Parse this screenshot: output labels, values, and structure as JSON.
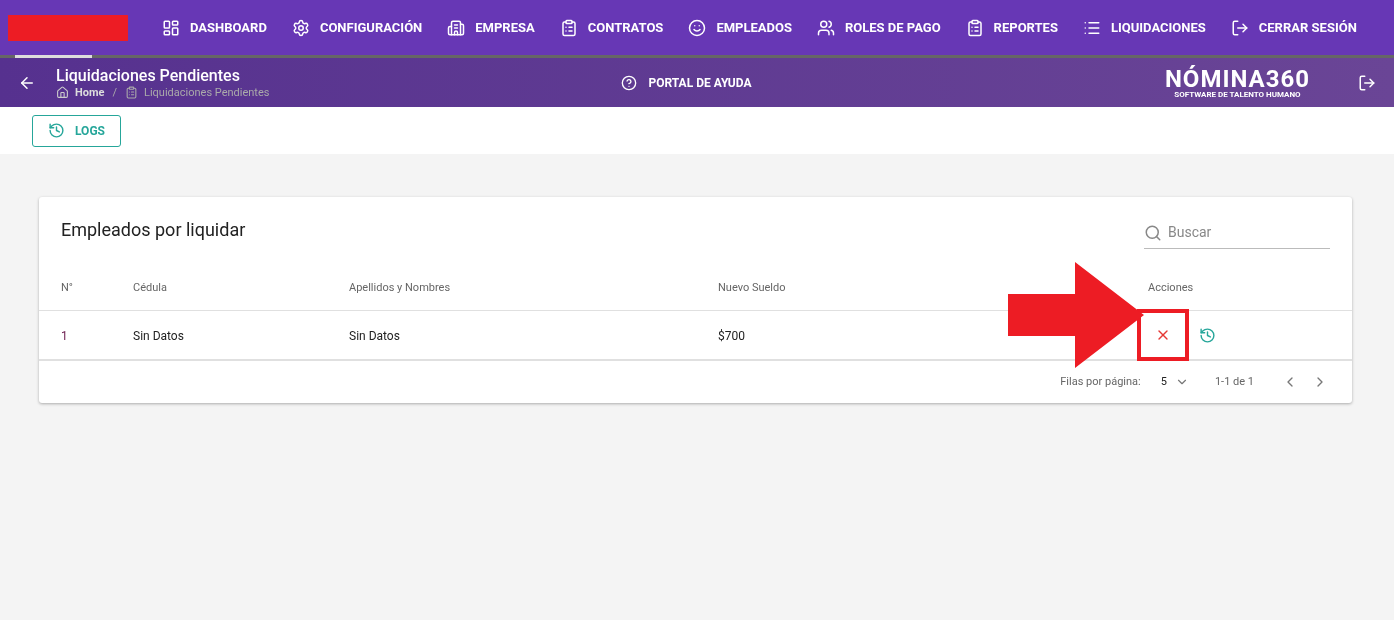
{
  "nav": {
    "items": [
      {
        "label": "DASHBOARD",
        "kind": "dashboard"
      },
      {
        "label": "CONFIGURACIÓN",
        "kind": "settings"
      },
      {
        "label": "EMPRESA",
        "kind": "building"
      },
      {
        "label": "CONTRATOS",
        "kind": "clipboard"
      },
      {
        "label": "EMPLEADOS",
        "kind": "face"
      },
      {
        "label": "ROLES DE PAGO",
        "kind": "people"
      },
      {
        "label": "REPORTES",
        "kind": "clipboard"
      },
      {
        "label": "LIQUIDACIONES",
        "kind": "list"
      },
      {
        "label": "CERRAR SESIÓN",
        "kind": "logout"
      }
    ]
  },
  "header": {
    "title": "Liquidaciones Pendientes",
    "breadcrumb": [
      "Home",
      "Liquidaciones Pendientes"
    ],
    "separator": "/",
    "help": "PORTAL DE AYUDA",
    "logo": {
      "name": "NÓMINA360",
      "tagline": "SOFTWARE DE TALENTO HUMANO"
    }
  },
  "toolbar": {
    "button": "LOGS"
  },
  "card": {
    "title": "Empleados por liquidar",
    "search": {
      "placeholder": "Buscar"
    },
    "columns": [
      "N°",
      "Cédula",
      "Apellidos y Nombres",
      "Nuevo Sueldo",
      "Acciones"
    ],
    "rows": [
      {
        "cells": [
          "1",
          "Sin Datos",
          "Sin Datos",
          "$700"
        ]
      }
    ],
    "footer": {
      "rows_label": "Filas por página:",
      "rows_value": "5",
      "range": "1-1 de 1"
    }
  }
}
